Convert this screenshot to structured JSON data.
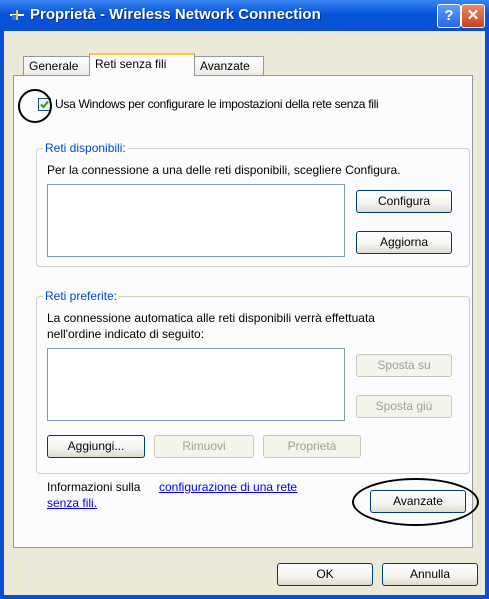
{
  "window": {
    "title": "Proprietà - Wireless Network Connection",
    "help_label": "?",
    "close_label": "✕"
  },
  "tabs": [
    {
      "label": "Generale"
    },
    {
      "label": "Reti senza fili"
    },
    {
      "label": "Avanzate"
    }
  ],
  "use_windows_checkbox": {
    "label": "Usa Windows per configurare le impostazioni della rete senza fili",
    "checked": true
  },
  "available": {
    "legend": "Reti disponibili:",
    "description": "Per la connessione a una delle reti disponibili, scegliere Configura.",
    "configure_label": "Configura",
    "refresh_label": "Aggiorna"
  },
  "preferred": {
    "legend": "Reti preferite:",
    "description_line1": "La connessione automatica alle reti disponibili verrà effettuata",
    "description_line2": "nell'ordine indicato di seguito:",
    "move_up_label": "Sposta su",
    "move_down_label": "Sposta giù",
    "add_label": "Aggiungi...",
    "remove_label": "Rimuovi",
    "properties_label": "Proprietà"
  },
  "info": {
    "text": "Informazioni sulla ",
    "link_line1": "configurazione di una rete",
    "link_line2": "senza fili."
  },
  "advanced_button_label": "Avanzate",
  "ok_label": "OK",
  "cancel_label": "Annulla"
}
